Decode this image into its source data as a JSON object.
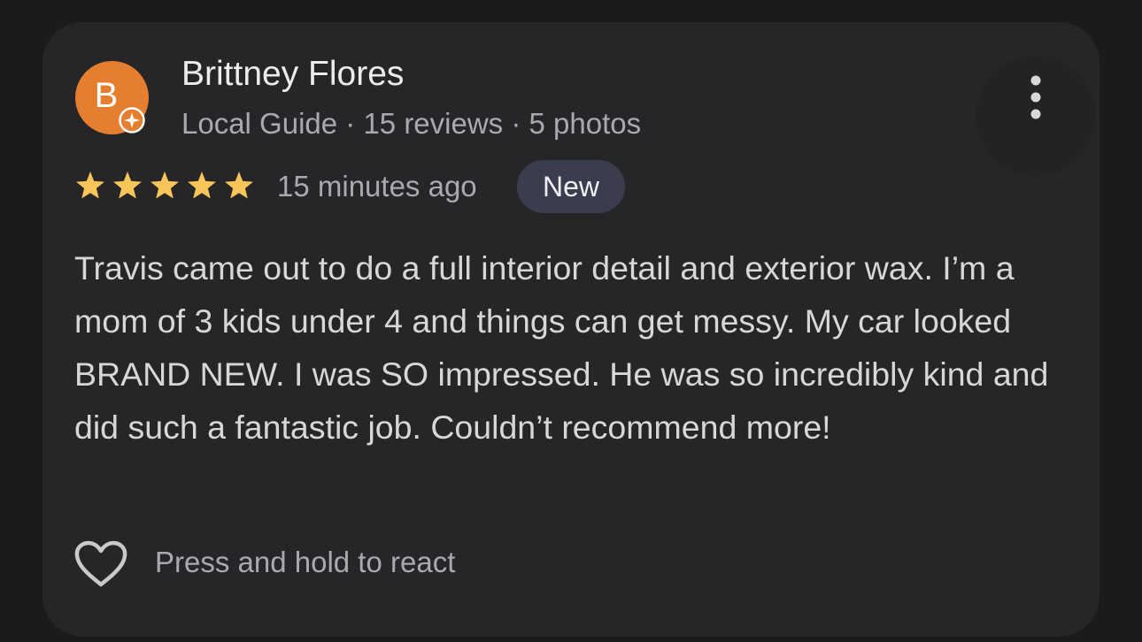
{
  "review": {
    "reviewer": {
      "initial": "B",
      "name": "Brittney Flores",
      "meta": "Local Guide · 15 reviews · 5 photos",
      "avatar_color": "#e57e2e"
    },
    "rating": {
      "value": 5,
      "max": 5,
      "star_color": "#f7c55a"
    },
    "time": "15 minutes ago",
    "badge": "New",
    "text": "Travis came out to do a full interior detail and exterior wax. I’m a mom of 3 kids under 4 and things can get messy. My car looked BRAND NEW. I was SO impressed. He was so incredibly kind and did such a fantastic job. Couldn’t recommend more!",
    "react_label": "Press and hold to react",
    "icons": {
      "badge": "local-guide-star-icon",
      "menu": "more-vertical-icon",
      "react": "heart-outline-icon"
    }
  }
}
